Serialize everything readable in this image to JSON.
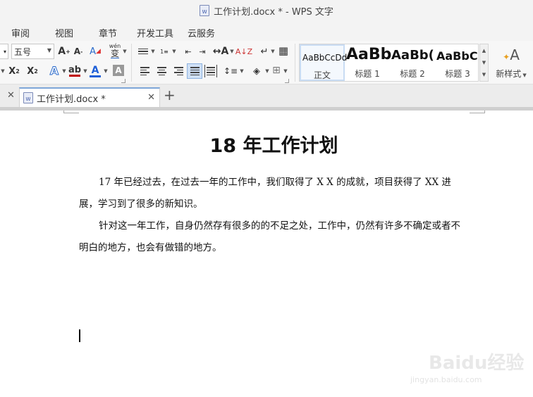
{
  "window": {
    "title": "工作计划.docx * - WPS 文字"
  },
  "menu": [
    "审阅",
    "视图",
    "章节",
    "开发工具",
    "云服务"
  ],
  "ribbon": {
    "font_size": "五号",
    "phonetic_label": "wén",
    "styles": [
      {
        "sample": "AaBbCcDd",
        "name": "正文"
      },
      {
        "sample": "AaBb",
        "name": "标题 1"
      },
      {
        "sample": "AaBb(",
        "name": "标题 2"
      },
      {
        "sample": "AaBbC",
        "name": "标题 3"
      }
    ],
    "new_style_label": "新样式",
    "colors": {
      "font_color_bar": "#ff0000",
      "text_color_bar": "#1e5fd8",
      "highlight_bar": "#c00000"
    }
  },
  "tabs": {
    "active": "工作计划.docx *"
  },
  "document": {
    "title": "18 年工作计划",
    "paragraphs": [
      "17 年已经过去，在过去一年的工作中，我们取得了 X X 的成就，项目获得了 XX 进展，学习到了很多的新知识。",
      "针对这一年工作，自身仍然存有很多的的不足之处，工作中，仍然有许多不确定或者不明白的地方，也会有做错的地方。"
    ]
  },
  "watermark": {
    "main": "Baidu经验",
    "sub": "jingyan.baidu.com"
  }
}
